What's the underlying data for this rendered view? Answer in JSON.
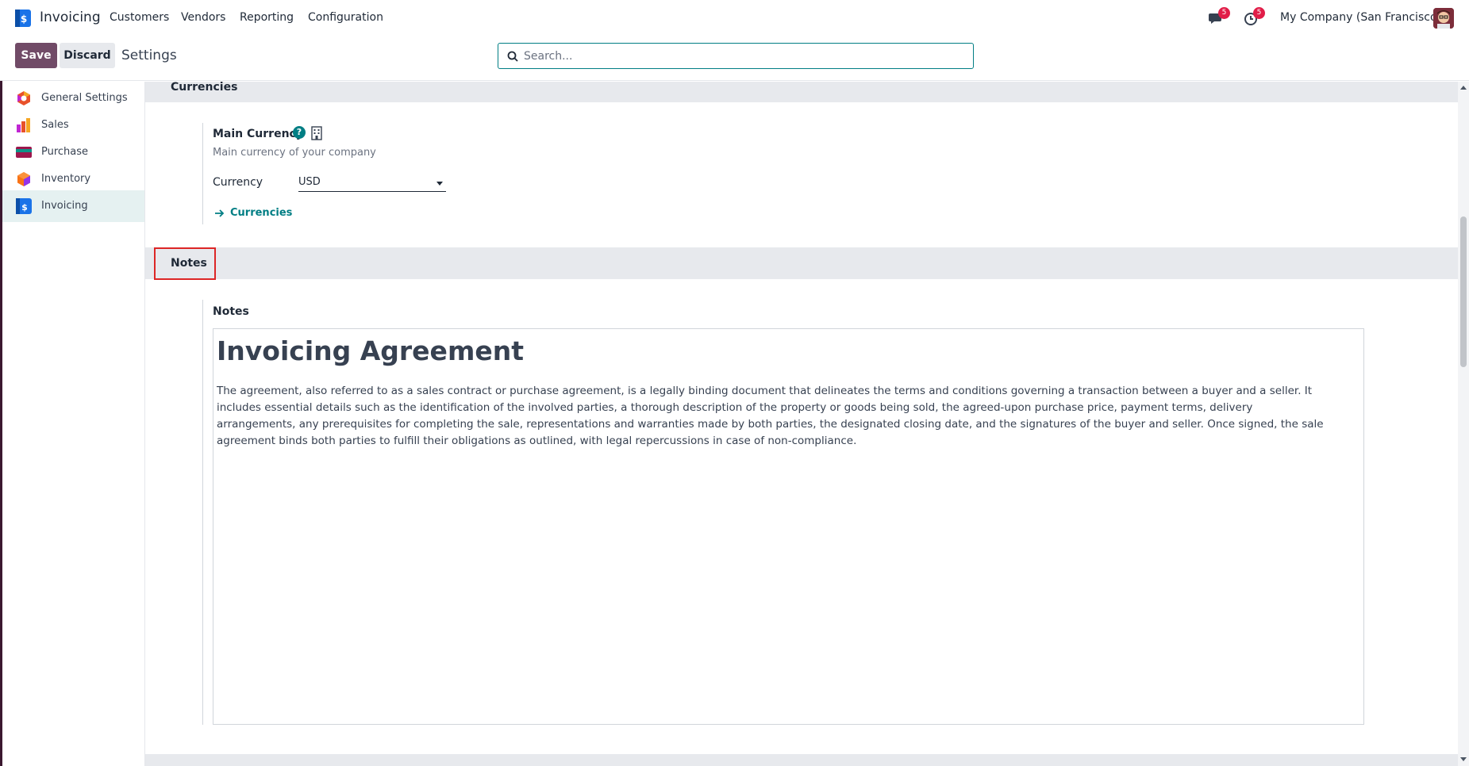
{
  "navbar": {
    "app_name": "Invoicing",
    "menu": [
      "Customers",
      "Vendors",
      "Reporting",
      "Configuration"
    ],
    "messages_badge": "5",
    "activities_badge": "5",
    "company": "My Company (San Francisco)"
  },
  "control_panel": {
    "save_label": "Save",
    "discard_label": "Discard",
    "title": "Settings",
    "search_placeholder": "Search..."
  },
  "sidebar": {
    "items": [
      {
        "label": "General Settings",
        "icon": "general-settings-icon"
      },
      {
        "label": "Sales",
        "icon": "sales-icon"
      },
      {
        "label": "Purchase",
        "icon": "purchase-icon"
      },
      {
        "label": "Inventory",
        "icon": "inventory-icon"
      },
      {
        "label": "Invoicing",
        "icon": "invoicing-icon",
        "active": true
      }
    ]
  },
  "currencies_section": {
    "title": "Currencies",
    "main_currency_title": "Main Currency",
    "main_currency_desc": "Main currency of your company",
    "currency_label": "Currency",
    "currency_value": "USD",
    "currencies_link": "Currencies"
  },
  "notes_section": {
    "title": "Notes",
    "field_label": "Notes",
    "heading": "Invoicing Agreement",
    "body": "The agreement, also referred to as a sales contract or purchase agreement, is a legally binding document that delineates the terms and conditions governing a transaction between a buyer and a seller. It includes essential details such as the identification of the involved parties, a thorough description of the property or goods being sold, the agreed-upon purchase price, payment terms, delivery arrangements, any prerequisites for completing the sale, representations and warranties made by both parties, the designated closing date, and the signatures of the buyer and seller. Once signed, the sale agreement binds both parties to fulfill their obligations as outlined, with legal repercussions in case of non-compliance."
  },
  "colors": {
    "brand": "#714b67",
    "accent": "#017e84",
    "badge": "#e11d48",
    "highlight": "#dc2626"
  }
}
